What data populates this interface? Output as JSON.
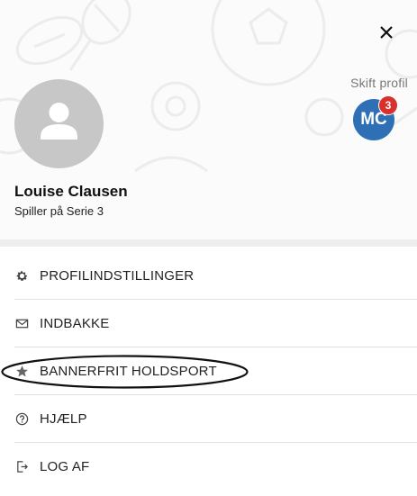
{
  "profile": {
    "name": "Louise Clausen",
    "role": "Spiller på Serie 3"
  },
  "switcher": {
    "label": "Skift profil",
    "initials": "MC",
    "badge_count": "3"
  },
  "menu": {
    "items": [
      {
        "label": "PROFILINDSTILLINGER",
        "icon": "gear-icon"
      },
      {
        "label": "INDBAKKE",
        "icon": "envelope-icon"
      },
      {
        "label": "BANNERFRIT HOLDSPORT",
        "icon": "star-icon"
      },
      {
        "label": "HJÆLP",
        "icon": "help-circle-icon"
      },
      {
        "label": "LOG AF",
        "icon": "logout-icon"
      }
    ]
  },
  "colors": {
    "accent": "#2f6fb5",
    "badge": "#d9302c",
    "avatar_bg": "#c7c7c7"
  }
}
